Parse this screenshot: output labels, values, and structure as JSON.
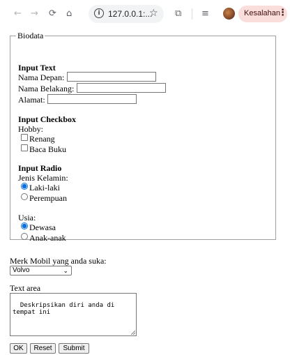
{
  "browser": {
    "url": "127.0.0.1:...",
    "error_label": "Kesalahan",
    "icons": [
      "back-arrow-icon",
      "forward-arrow-icon",
      "reload-icon",
      "home-icon",
      "info-icon",
      "star-icon",
      "extensions-icon",
      "reading-list-icon",
      "avatar",
      "more-menu-icon"
    ]
  },
  "form": {
    "legend": "Biodata",
    "input_text": {
      "heading": "Input Text",
      "nama_depan_label": "Nama Depan:",
      "nama_belakang_label": "Nama Belakang:",
      "alamat_label": "Alamat:",
      "nama_depan_value": "",
      "nama_belakang_value": "",
      "alamat_value": ""
    },
    "input_checkbox": {
      "heading": "Input Checkbox",
      "hobby_label": "Hobby:",
      "options": [
        {
          "label": "Renang",
          "checked": false
        },
        {
          "label": "Baca Buku",
          "checked": false
        }
      ]
    },
    "input_radio": {
      "heading": "Input Radio",
      "gender_label": "Jenis Kelamin:",
      "gender_options": [
        {
          "label": "Laki-laki",
          "selected": true
        },
        {
          "label": "Perempuan",
          "selected": false
        }
      ],
      "age_label": "Usia:",
      "age_options": [
        {
          "label": "Dewasa",
          "selected": true
        },
        {
          "label": "Anak-anak",
          "selected": false
        }
      ]
    }
  },
  "car": {
    "label": "Merk Mobil yang anda suka:",
    "selected": "Volvo"
  },
  "textarea": {
    "label": "Text area",
    "value": "Deskripsikan diri anda di tempat ini"
  },
  "buttons": {
    "ok": "OK",
    "reset": "Reset",
    "submit": "Submit"
  },
  "colors": {
    "accent": "#0b6fe0",
    "error_pill": "#f9dedc"
  }
}
